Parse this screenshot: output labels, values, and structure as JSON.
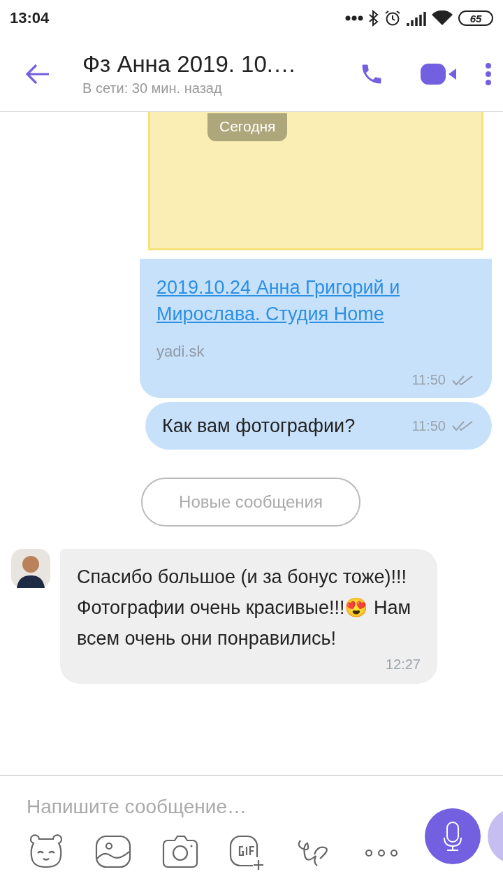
{
  "status_bar": {
    "time": "13:04",
    "battery": "65"
  },
  "header": {
    "title": "Фз Анна 2019. 10.…",
    "subtitle": "В сети: 30 мин. назад"
  },
  "date_pill": "Сегодня",
  "messages": [
    {
      "kind": "link",
      "link": "2019.10.24 Анна Григорий и Мирослава. Студия Home",
      "domain": "yadi.sk",
      "time": "11:50"
    },
    {
      "kind": "outgoing",
      "text": "Как вам фотографии?",
      "time": "11:50"
    },
    {
      "kind": "divider",
      "text": "Новые сообщения"
    },
    {
      "kind": "incoming",
      "text": "Спасибо большое (и за бонус тоже)!!! Фотографии очень красивые!!!😍 Нам всем очень они понравились!",
      "time": "12:27"
    }
  ],
  "composer": {
    "placeholder": "Напишите сообщение…"
  }
}
